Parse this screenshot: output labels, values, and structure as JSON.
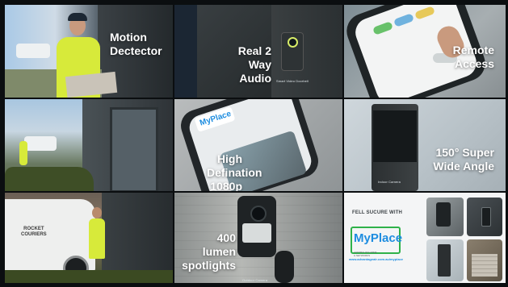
{
  "tiles": {
    "t1": {
      "caption": [
        "Motion",
        "Dectector"
      ]
    },
    "t2": {
      "caption": [
        "Real 2 Way",
        "Audio"
      ],
      "device_label": "Smart Video Doorbell"
    },
    "t3": {
      "caption": [
        "Remote",
        "Access"
      ]
    },
    "t4": {},
    "t5": {
      "caption": [
        "High",
        "Defination",
        "1080p"
      ],
      "app_logo": "MyPlace"
    },
    "t6": {
      "caption": [
        "150° Super",
        "Wide Angle"
      ],
      "device_label": "Indoor Camera"
    },
    "t7": {
      "van_text": [
        "ROCKET",
        "COURIERS"
      ]
    },
    "t8": {
      "caption": [
        "400 lumen",
        "spotlights"
      ],
      "device_label": "Outdoor Camera"
    },
    "t9": {
      "heading": "FELL SUCURE WITH",
      "logo": "MyPlace",
      "logo_sub": [
        "AUSTRALIAN HOME",
        "& NETWORKS"
      ],
      "url": "www.advantageair.com.au/myplace"
    }
  },
  "colors": {
    "accent_blue": "#1e8de0",
    "logo_green": "#2fb24a",
    "hivis": "#d7ea3a"
  }
}
